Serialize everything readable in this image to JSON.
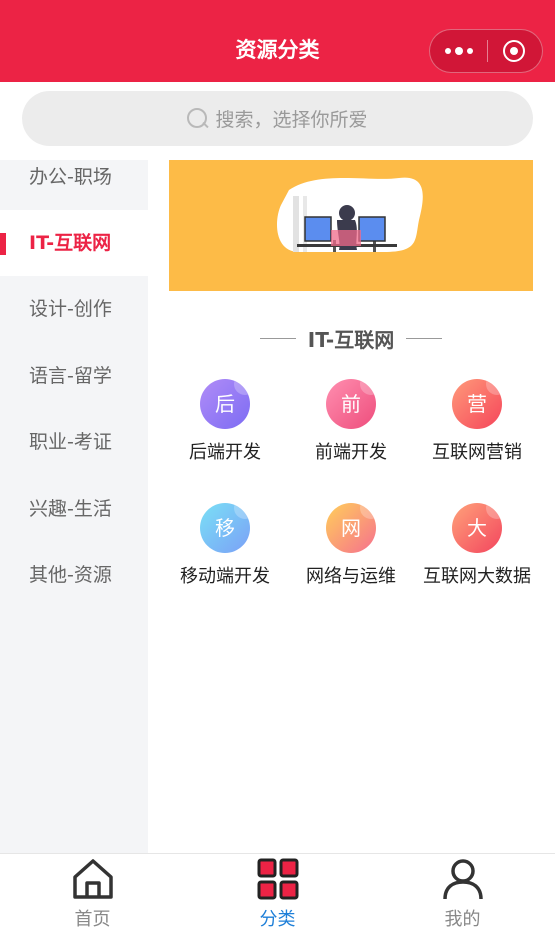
{
  "header": {
    "title": "资源分类"
  },
  "search": {
    "placeholder": "搜索，选择你所爱"
  },
  "sidebar": {
    "items": [
      {
        "label": "办公-职场"
      },
      {
        "label": "IT-互联网"
      },
      {
        "label": "设计-创作"
      },
      {
        "label": "语言-留学"
      },
      {
        "label": "职业-考证"
      },
      {
        "label": "兴趣-生活"
      },
      {
        "label": "其他-资源"
      }
    ],
    "active": "IT-互联网"
  },
  "section": {
    "title": "IT-互联网"
  },
  "categories": [
    {
      "icon_text": "后",
      "label": "后端开发",
      "color": "#8a7cf5"
    },
    {
      "icon_text": "前",
      "label": "前端开发",
      "color": "#f2678f"
    },
    {
      "icon_text": "营",
      "label": "互联网营销",
      "color": "#f86a63"
    },
    {
      "icon_text": "移",
      "label": "移动端开发",
      "color": "#66b2f5"
    },
    {
      "icon_text": "网",
      "label": "网络与运维",
      "color": "#f7a47a"
    },
    {
      "icon_text": "大",
      "label": "互联网大数据",
      "color": "#f7696b"
    }
  ],
  "tabbar": {
    "items": [
      {
        "label": "首页",
        "icon": "home-icon"
      },
      {
        "label": "分类",
        "icon": "category-icon"
      },
      {
        "label": "我的",
        "icon": "user-icon"
      }
    ],
    "active": "分类"
  },
  "colors": {
    "brand": "#ec2345",
    "banner": "#fdbb47",
    "tab_active": "#1e7fd8"
  }
}
